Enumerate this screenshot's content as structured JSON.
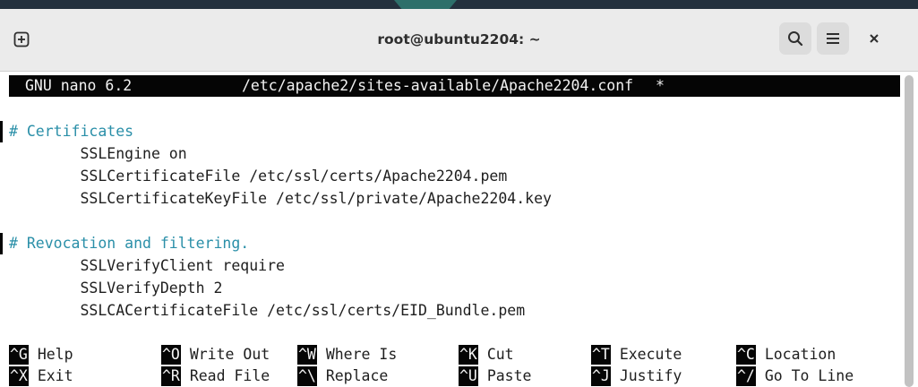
{
  "window": {
    "title": "root@ubuntu2204: ~"
  },
  "nano": {
    "version": "GNU nano 6.2",
    "filename": "/etc/apache2/sites-available/Apache2204.conf",
    "modified_marker": "*"
  },
  "editor": {
    "lines": [
      {
        "text": "",
        "type": "blank"
      },
      {
        "text": "# Certificates",
        "type": "comment"
      },
      {
        "text": "        SSLEngine on",
        "type": "code"
      },
      {
        "text": "        SSLCertificateFile /etc/ssl/certs/Apache2204.pem",
        "type": "code"
      },
      {
        "text": "        SSLCertificateKeyFile /etc/ssl/private/Apache2204.key",
        "type": "code"
      },
      {
        "text": "",
        "type": "blank"
      },
      {
        "text": "# Revocation and filtering.",
        "type": "comment"
      },
      {
        "text": "        SSLVerifyClient require",
        "type": "code"
      },
      {
        "text": "        SSLVerifyDepth 2",
        "type": "code"
      },
      {
        "text": "        SSLCACertificateFile /etc/ssl/certs/EID_Bundle.pem",
        "type": "code"
      }
    ]
  },
  "shortcuts": [
    {
      "key": "^G",
      "label": "Help"
    },
    {
      "key": "^O",
      "label": "Write Out"
    },
    {
      "key": "^W",
      "label": "Where Is"
    },
    {
      "key": "^K",
      "label": "Cut"
    },
    {
      "key": "^T",
      "label": "Execute"
    },
    {
      "key": "^C",
      "label": "Location"
    },
    {
      "key": "^X",
      "label": "Exit"
    },
    {
      "key": "^R",
      "label": "Read File"
    },
    {
      "key": "^\\",
      "label": "Replace"
    },
    {
      "key": "^U",
      "label": "Paste"
    },
    {
      "key": "^J",
      "label": "Justify"
    },
    {
      "key": "^/",
      "label": "Go To Line"
    }
  ],
  "icons": {
    "new_tab": "new-tab-icon",
    "search": "search-icon",
    "menu": "hamburger-menu-icon",
    "close": "close-icon"
  },
  "colors": {
    "comment": "#2a8fa8",
    "header_bg": "#050505",
    "titlebar_bg": "#ebebeb"
  }
}
